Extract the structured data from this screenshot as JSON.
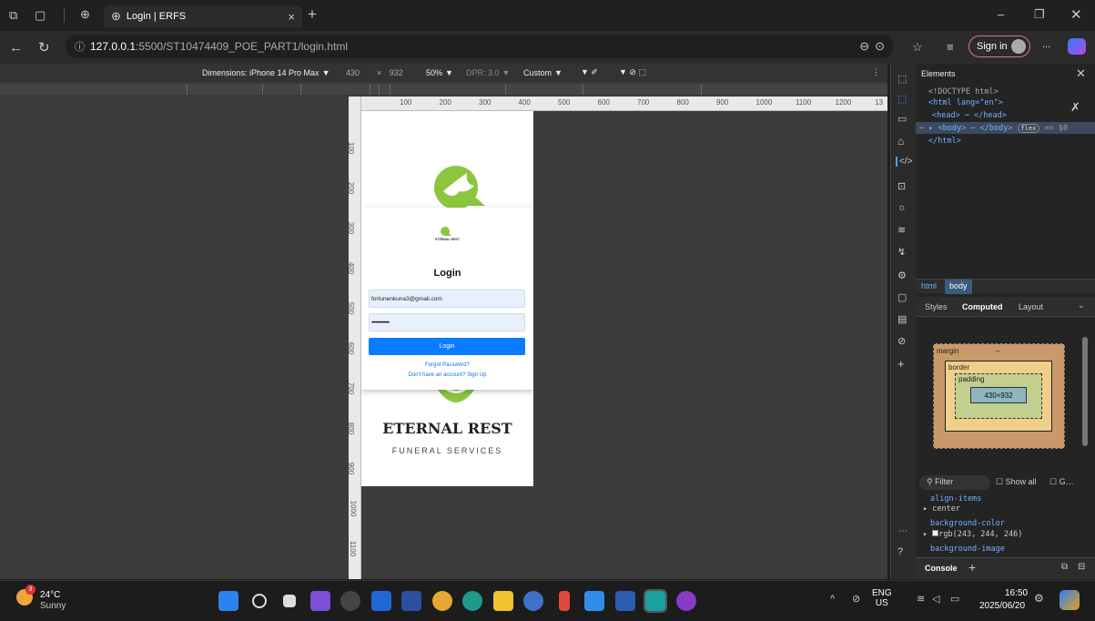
{
  "browser": {
    "tab_title": "Login | ERFS",
    "url_host": "127.0.0.1",
    "url_rest": ":5500/ST10474409_POE_PART1/login.html",
    "sign_in": "Sign in",
    "menu": "..."
  },
  "device_toolbar": {
    "dimensions": "Dimensions: iPhone 14 Pro Max",
    "width": "430",
    "x": "×",
    "height": "932",
    "zoom": "50%",
    "dpr": "DPR: 3.0",
    "throttle": "Custom"
  },
  "ruler": {
    "h_ticks": [
      "100",
      "200",
      "300",
      "400",
      "500",
      "600",
      "700",
      "800",
      "900",
      "1000",
      "1100",
      "1200",
      "13"
    ],
    "v_ticks": [
      "100",
      "200",
      "300",
      "400",
      "500",
      "600",
      "700",
      "800",
      "900",
      "1000",
      "1100"
    ]
  },
  "page": {
    "brand_small": "ETERNAL REST",
    "login_title": "Login",
    "email_value": "fortunenkuna3@gmail.com",
    "password_value": "•••••••••••••••",
    "login_button": "Login",
    "forgot": "Forgot Password?",
    "signup": "Don't have an account? Sign Up",
    "brand_title": "ETERNAL REST",
    "brand_sub": "FUNERAL SERVICES"
  },
  "devtools": {
    "panel_title": "Elements",
    "dom": [
      "<!DOCTYPE html>",
      "<html lang=\"en\">",
      "<head> ⋯ </head>",
      "<body> ⋯ </body>",
      "</html>"
    ],
    "body_badge": "flex",
    "body_eq": "== $0",
    "crumbs": [
      "html",
      "body"
    ],
    "tabs": [
      "Styles",
      "Computed",
      "Layout"
    ],
    "box": {
      "margin": "margin",
      "border": "border",
      "padding": "padding",
      "content": "430×932",
      "dash": "–"
    },
    "filter": "Filter",
    "show_all": "Show all",
    "group": "G…",
    "props": [
      {
        "name": "align-items",
        "value": "center"
      },
      {
        "name": "background-color",
        "value": "rgb(243, 244, 246)"
      },
      {
        "name": "background-image",
        "value": ""
      }
    ],
    "console": "Console"
  },
  "taskbar": {
    "weather_temp": "24°C",
    "weather_desc": "Sunny",
    "weather_badge": "3",
    "lang1": "ENG",
    "lang2": "US",
    "time": "16:50",
    "date": "2025/06/20"
  },
  "colors": {
    "brand_green": "#8cc63f",
    "accent": "#0a7cff"
  }
}
